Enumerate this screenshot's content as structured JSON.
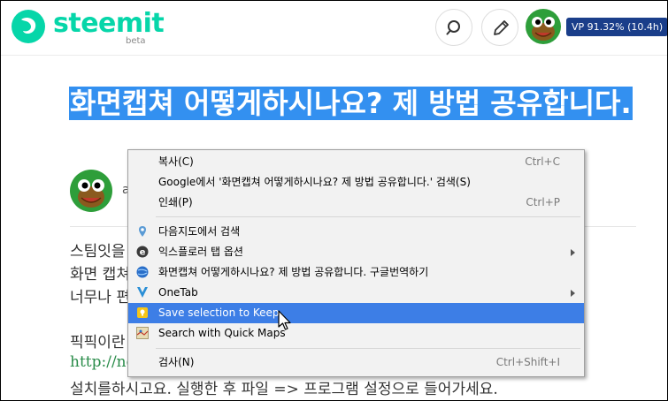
{
  "header": {
    "logo": "steemit",
    "beta": "beta",
    "vp_badge": "VP 91.32% (10.4h)"
  },
  "article": {
    "title": "화면캡쳐 어떻게하시나요? 제 방법 공유합니다.",
    "author_fragment": "a",
    "body_lines": [
      "스팀잇을",
      "화면 캡쳐",
      "너무나 편",
      "픽픽이란",
      "http://ng",
      "설치를하시고요. 실행한 후 파일 => 프로그램 설정으로 들어가세요."
    ]
  },
  "context_menu": {
    "items": [
      {
        "label": "복사(C)",
        "shortcut": "Ctrl+C"
      },
      {
        "label": "Google에서 '화면캡쳐 어떻게하시나요? 제 방법 공유합니다.' 검색(S)",
        "shortcut": ""
      },
      {
        "label": "인쇄(P)",
        "shortcut": "Ctrl+P"
      },
      {
        "label": "다음지도에서 검색",
        "icon": "map-pin-icon"
      },
      {
        "label": "익스플로러 탭 옵션",
        "icon": "ie-tab-icon",
        "submenu": true
      },
      {
        "label": "화면캡쳐 어떻게하시나요? 제 방법 공유합니다. 구글번역하기",
        "icon": "globe-translate-icon"
      },
      {
        "label": "OneTab",
        "icon": "onetab-icon",
        "submenu": true
      },
      {
        "label": "Save selection to Keep",
        "icon": "keep-icon",
        "highlighted": true
      },
      {
        "label": "Search with Quick Maps",
        "icon": "quick-maps-icon"
      },
      {
        "label": "검사(N)",
        "shortcut": "Ctrl+Shift+I"
      }
    ]
  },
  "colors": {
    "brand": "#06d6a9",
    "selection": "#3390f0",
    "menu_highlight": "#3d7ee6",
    "vp_badge": "#1a3e8a"
  }
}
